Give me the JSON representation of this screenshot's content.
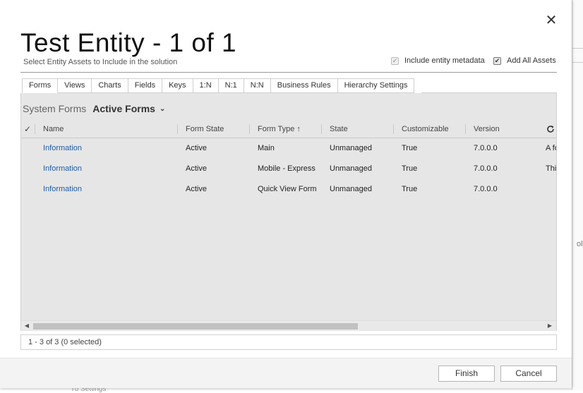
{
  "dialog": {
    "title": "Test Entity - 1 of 1",
    "subtitle": "Select Entity Assets to Include in the solution",
    "close_glyph": "✕",
    "options": [
      {
        "label": "Include entity metadata",
        "checked": true,
        "disabled": true
      },
      {
        "label": "Add All Assets",
        "checked": true,
        "disabled": false
      }
    ]
  },
  "tabs": [
    {
      "label": "Forms",
      "active": true
    },
    {
      "label": "Views"
    },
    {
      "label": "Charts"
    },
    {
      "label": "Fields"
    },
    {
      "label": "Keys"
    },
    {
      "label": "1:N"
    },
    {
      "label": "N:1"
    },
    {
      "label": "N:N"
    },
    {
      "label": "Business Rules"
    },
    {
      "label": "Hierarchy Settings"
    }
  ],
  "view": {
    "label": "System Forms",
    "selected": "Active Forms",
    "chevron": "⌄"
  },
  "grid": {
    "checkall_glyph": "✓",
    "columns": [
      "Name",
      "Form State",
      "Form Type ↑",
      "State",
      "Customizable",
      "Version"
    ],
    "rows": [
      {
        "name": "Information",
        "form_state": "Active",
        "form_type": "Main",
        "state": "Unmanaged",
        "customizable": "True",
        "version": "7.0.0.0",
        "desc": "A fo"
      },
      {
        "name": "Information",
        "form_state": "Active",
        "form_type": "Mobile - Express",
        "state": "Unmanaged",
        "customizable": "True",
        "version": "7.0.0.0",
        "desc": "This"
      },
      {
        "name": "Information",
        "form_state": "Active",
        "form_type": "Quick View Form",
        "state": "Unmanaged",
        "customizable": "True",
        "version": "7.0.0.0",
        "desc": ""
      }
    ]
  },
  "scroll": {
    "left": "◀",
    "right": "▶"
  },
  "status": "1 - 3 of 3 (0 selected)",
  "footer": {
    "finish": "Finish",
    "cancel": "Cancel"
  },
  "background_fragments": {
    "side": "ol",
    "bottom": "Tu Settings"
  },
  "icons": [
    "close-icon",
    "check-icon",
    "chevron-down-icon",
    "sort-up-icon",
    "refresh-icon",
    "scroll-left-icon",
    "scroll-right-icon"
  ],
  "colors": {
    "link": "#1f5ca8",
    "grid_bg": "#e6e6e6",
    "footer_bg": "#f3f3f3"
  }
}
